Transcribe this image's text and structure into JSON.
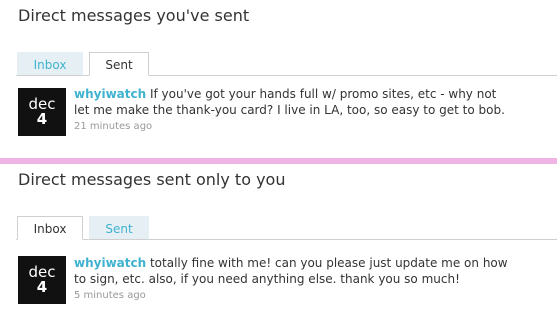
{
  "sent_section": {
    "title": "Direct messages you've sent",
    "tabs": {
      "inbox": "Inbox",
      "sent": "Sent"
    },
    "active_tab": "Sent",
    "message": {
      "avatar": {
        "line1": "dec",
        "line2": "4"
      },
      "username": "whyiwatch",
      "text": "If you've got your hands full w/ promo sites, etc - why not let me make the thank-you card? I live in LA, too, so easy to get to bob.",
      "time": "21 minutes ago"
    }
  },
  "received_section": {
    "title": "Direct messages sent only to you",
    "tabs": {
      "inbox": "Inbox",
      "sent": "Sent"
    },
    "active_tab": "Inbox",
    "message": {
      "avatar": {
        "line1": "dec",
        "line2": "4"
      },
      "username": "whyiwatch",
      "text": "totally fine with me! can you please just update me on how to sign, etc. also, if you need anything else. thank you so much!",
      "time": "5 minutes ago"
    }
  },
  "colors": {
    "link": "#3fb2cf",
    "divider": "#efb3e4",
    "inactive_tab_bg": "#e6f0f4"
  }
}
